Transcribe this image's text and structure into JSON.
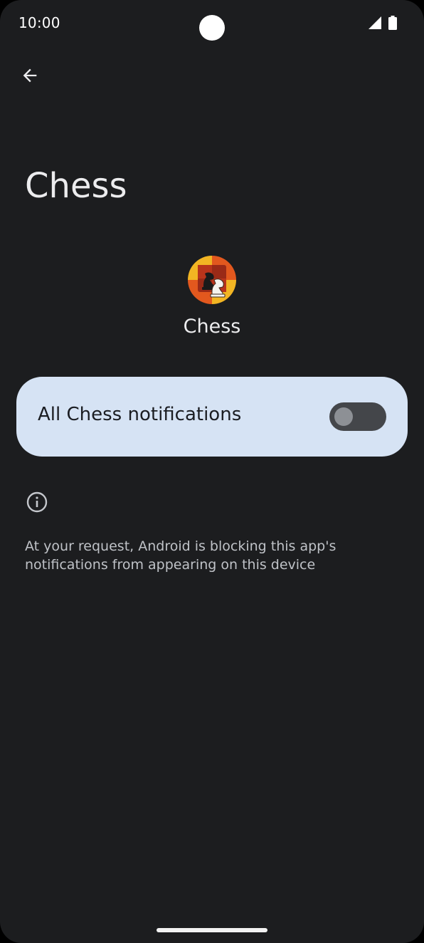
{
  "status_bar": {
    "time": "10:00",
    "icons": [
      "signal-icon",
      "battery-icon"
    ]
  },
  "header": {
    "back_icon": "arrow-left-icon",
    "title": "Chess"
  },
  "app": {
    "name": "Chess",
    "icon": "chess-app-icon"
  },
  "toggle": {
    "label": "All Chess notifications",
    "enabled": false
  },
  "info": {
    "icon": "info-icon",
    "text": "At your request, Android is blocking this app's notifications from appearing on this device"
  },
  "colors": {
    "background": "#1c1d1f",
    "card": "#d6e3f4",
    "switch_track": "#44464a",
    "switch_knob": "#8d9095"
  }
}
